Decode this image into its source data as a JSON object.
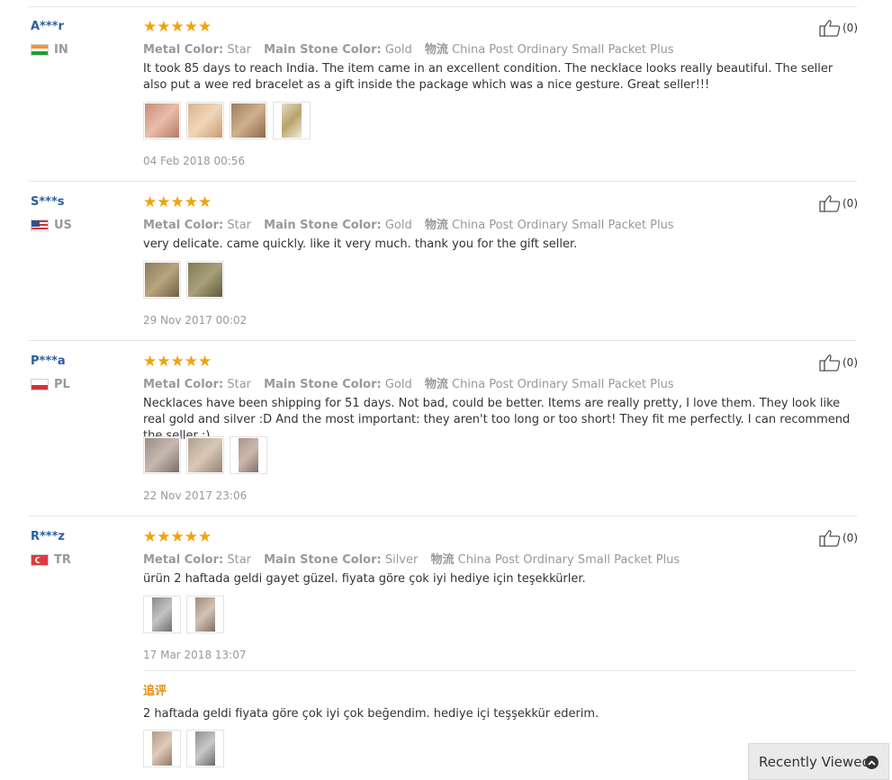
{
  "labels": {
    "metal_color": "Metal Color:",
    "main_stone_color": "Main Stone Color:",
    "shipping_label": "物流"
  },
  "reviews": [
    {
      "user": "A***r",
      "country": "IN",
      "stars": "★★★★★",
      "metal_color": "Star",
      "stone_color": "Gold",
      "shipping": "China Post Ordinary Small Packet Plus",
      "text": "It took 85 days to reach India. The item came in an excellent condition. The necklace looks really beautiful. The seller also put a wee red bracelet as a gift inside the package which was a nice gesture. Great seller!!!",
      "date": "04 Feb 2018 00:56",
      "helpful_count": "(0)"
    },
    {
      "user": "S***s",
      "country": "US",
      "stars": "★★★★★",
      "metal_color": "Star",
      "stone_color": "Gold",
      "shipping": "China Post Ordinary Small Packet Plus",
      "text": "very delicate. came quickly. like it very much. thank you for the gift seller.",
      "date": "29 Nov 2017 00:02",
      "helpful_count": "(0)"
    },
    {
      "user": "P***a",
      "country": "PL",
      "stars": "★★★★★",
      "metal_color": "Star",
      "stone_color": "Gold",
      "shipping": "China Post Ordinary Small Packet Plus",
      "text": "Necklaces have been shipping for 51 days. Not bad, could be better. Items are really pretty, I love them. They look like real gold and silver :D And the most important: they aren't too long or too short! They fit me perfectly. I can recommend the seller :)",
      "date": "22 Nov 2017 23:06",
      "helpful_count": "(0)"
    },
    {
      "user": "R***z",
      "country": "TR",
      "stars": "★★★★★",
      "metal_color": "Star",
      "stone_color": "Silver",
      "shipping": "China Post Ordinary Small Packet Plus",
      "text": "ürün 2 haftada geldi gayet güzel. fiyata göre çok iyi hediye için teşekkürler.",
      "date": "17 Mar 2018 13:07",
      "helpful_count": "(0)",
      "follow_up_label": "追评",
      "follow_up_text": "2 haftada geldi fiyata göre çok iyi çok beğendim. hediye içi teşşekkür ederim."
    }
  ],
  "recently_viewed": "Recently Viewed",
  "colors": {
    "star": "#f2a20c",
    "username": "#2b5e9f",
    "follow_label": "#e58f0e"
  }
}
